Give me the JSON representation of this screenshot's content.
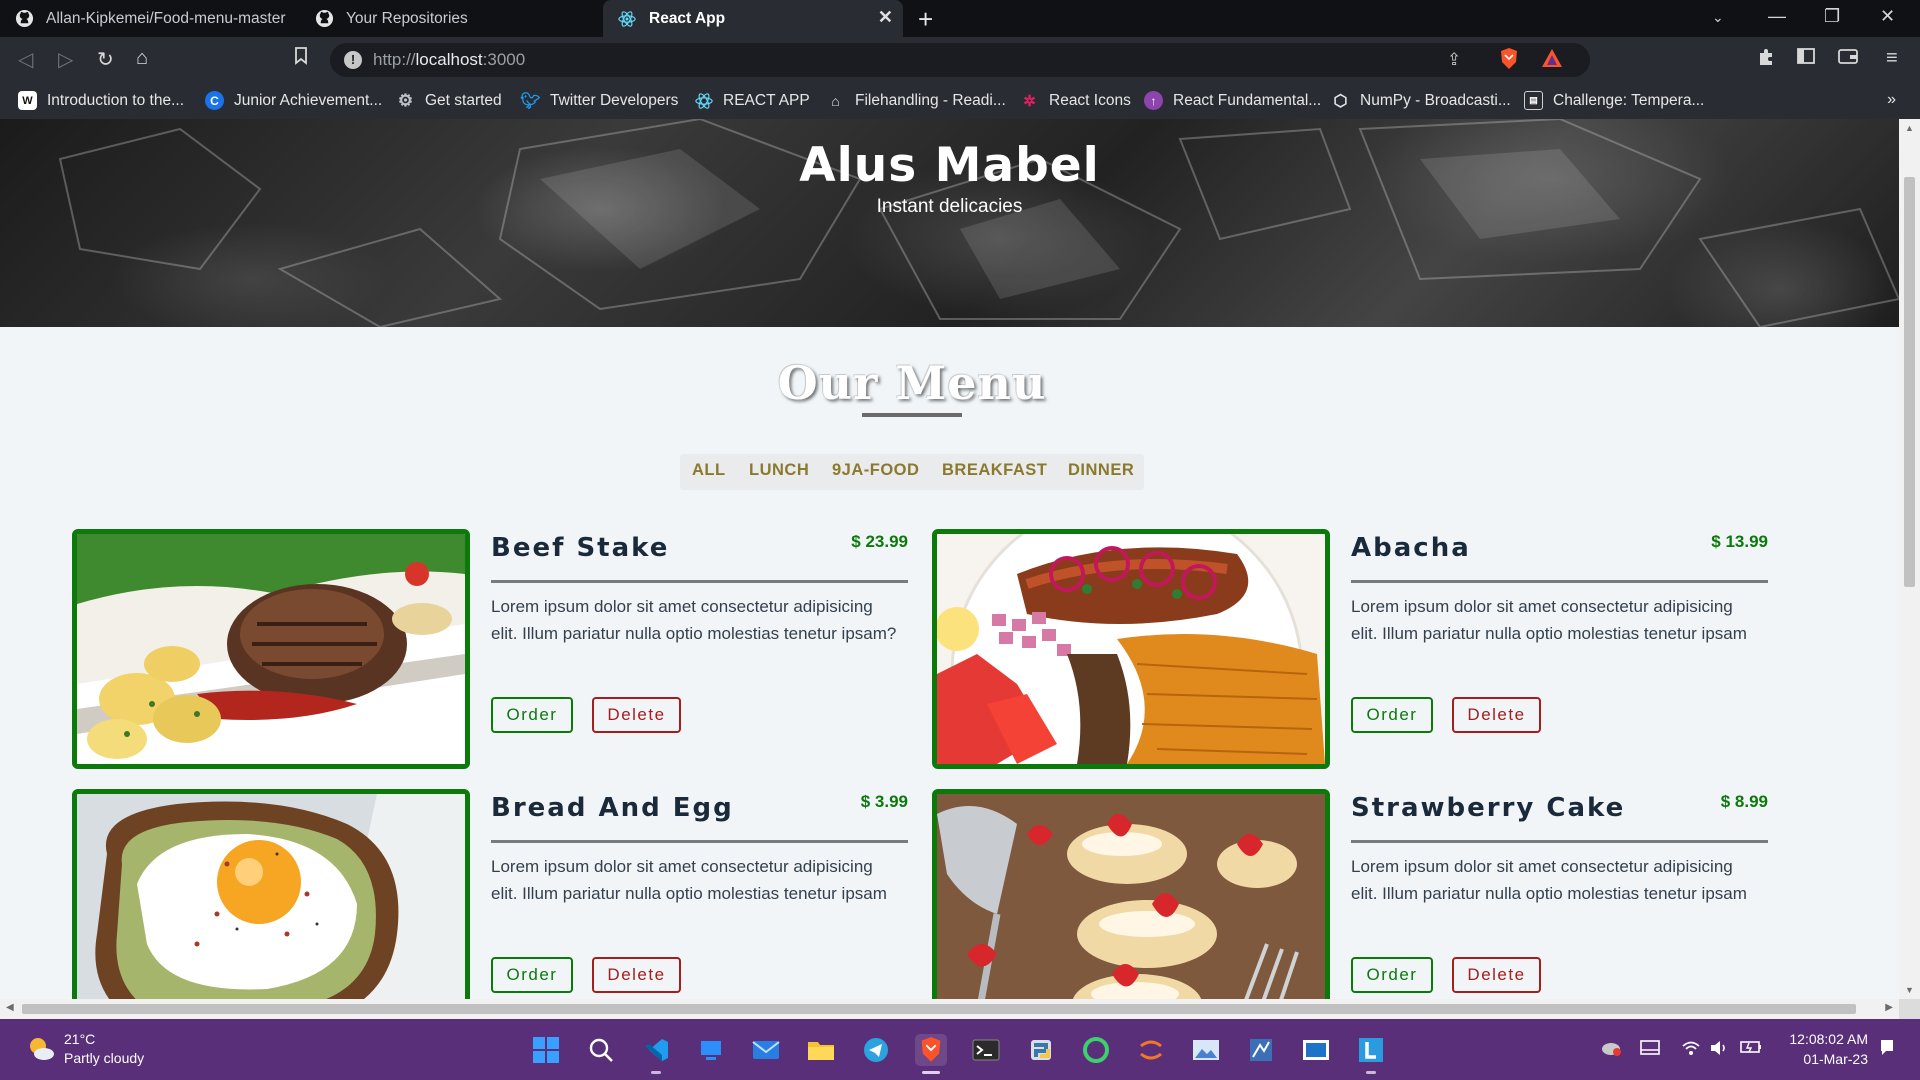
{
  "browser": {
    "tabs": [
      {
        "title": "Allan-Kipkemei/Food-menu-master",
        "icon": "github-icon",
        "active": false
      },
      {
        "title": "Your Repositories",
        "icon": "github-icon",
        "active": false
      },
      {
        "title": "React App",
        "icon": "react-icon",
        "active": true
      }
    ],
    "url_scheme": "http://",
    "url_host": "localhost",
    "url_port": ":3000",
    "bookmarks": [
      {
        "label": "Introduction to the...",
        "icon": "bookmark-favicon",
        "color": "#ffffff"
      },
      {
        "label": "Junior Achievement...",
        "icon": "c-favicon",
        "color": "#1a73e8"
      },
      {
        "label": "Get started",
        "icon": "gear-favicon",
        "color": "#9aa0a6"
      },
      {
        "label": "Twitter Developers",
        "icon": "twitter-favicon",
        "color": "#1d9bf0"
      },
      {
        "label": "REACT  APP",
        "icon": "react-favicon",
        "color": "#61dafb"
      },
      {
        "label": "Filehandling - Readi...",
        "icon": "file-favicon",
        "color": "#f0c14b"
      },
      {
        "label": "React Icons",
        "icon": "react-icons-favicon",
        "color": "#e91e63"
      },
      {
        "label": "React Fundamental...",
        "icon": "fundamentals-favicon",
        "color": "#8e44ad"
      },
      {
        "label": "NumPy - Broadcasti...",
        "icon": "numpy-favicon",
        "color": "#4dabcf"
      },
      {
        "label": "Challenge: Tempera...",
        "icon": "challenge-favicon",
        "color": "#9aa0a6"
      }
    ]
  },
  "hero": {
    "title": "Alus Mabel",
    "subtitle": "Instant delicacies"
  },
  "menu": {
    "title": "Our Menu",
    "filters": [
      "ALL",
      "LUNCH",
      "9JA-FOOD",
      "BREAKFAST",
      "DINNER"
    ],
    "order_label": "Order",
    "delete_label": "Delete",
    "items": [
      {
        "name": "Beef Stake",
        "price": "$ 23.99",
        "desc": "Lorem ipsum dolor sit amet consectetur adipisicing elit. Illum pariatur nulla optio molestias tenetur ipsam?"
      },
      {
        "name": "Abacha",
        "price": "$ 13.99",
        "desc": "Lorem ipsum dolor sit amet consectetur adipisicing elit. Illum pariatur nulla optio molestias tenetur ipsam"
      },
      {
        "name": "Bread And Egg",
        "price": "$ 3.99",
        "desc": "Lorem ipsum dolor sit amet consectetur adipisicing elit. Illum pariatur nulla optio molestias tenetur ipsam"
      },
      {
        "name": "Strawberry Cake",
        "price": "$ 8.99",
        "desc": "Lorem ipsum dolor sit amet consectetur adipisicing elit. Illum pariatur nulla optio molestias tenetur ipsam"
      }
    ]
  },
  "taskbar": {
    "weather_temp": "21°C",
    "weather_desc": "Partly cloudy",
    "time": "12:08:02 AM",
    "date": "01-Mar-23",
    "apps": [
      "start-icon",
      "search-icon",
      "vscode-icon",
      "task-view-icon",
      "mail-icon",
      "file-explorer-icon",
      "telegram-icon",
      "brave-icon",
      "terminal-icon",
      "python-icon",
      "circle-app-icon",
      "jupyter-icon",
      "photos-icon",
      "network-app-icon",
      "app-icon",
      "l-app-icon"
    ]
  },
  "colors": {
    "accent_green": "#0b7a0b",
    "delete_red": "#a51d1d",
    "filter_gold": "#8b7a2e",
    "taskbar_purple": "#5a2f79"
  }
}
